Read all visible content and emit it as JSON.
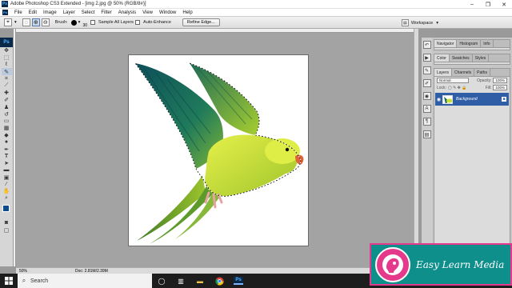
{
  "window": {
    "app_badge": "Ps",
    "title": "Adobe Photoshop CS3 Extended - [img 2.jpg @ 50% (RGB/8#)]",
    "controls": [
      "–",
      "❐",
      "✕"
    ]
  },
  "menu": [
    "File",
    "Edit",
    "Image",
    "Layer",
    "Select",
    "Filter",
    "Analysis",
    "View",
    "Window",
    "Help"
  ],
  "options": {
    "brush_label": "Brush:",
    "brush_size": "30",
    "sample_all_layers": "Sample All Layers",
    "auto_enhance": "Auto-Enhance",
    "refine_edge": "Refine Edge...",
    "workspace": "Workspace"
  },
  "toolbox": {
    "badge": "Ps",
    "tools": [
      "move",
      "marquee",
      "lasso",
      "quick-selection",
      "crop",
      "slice",
      "healing-brush",
      "brush",
      "clone-stamp",
      "history-brush",
      "eraser",
      "gradient",
      "blur",
      "dodge",
      "pen",
      "type",
      "path-selection",
      "shape",
      "notes",
      "eyedropper",
      "hand",
      "zoom"
    ],
    "colors": {
      "foreground": "#0d4d8f",
      "background": "#ffffff"
    }
  },
  "status": {
    "zoom": "50%",
    "doc": "Doc: 2.81M/2.39M"
  },
  "panels": {
    "navigator_tabs": [
      "Navigator",
      "Histogram",
      "Info"
    ],
    "color_tabs": [
      "Color",
      "Swatches",
      "Styles"
    ],
    "layers_tabs": [
      "Layers",
      "Channels",
      "Paths"
    ],
    "blend_mode": "Normal",
    "opacity_label": "Opacity:",
    "opacity_value": "100%",
    "lock_label": "Lock:",
    "fill_label": "Fill:",
    "fill_value": "100%",
    "layer_name": "Background"
  },
  "taskbar": {
    "search_placeholder": "Search"
  },
  "watermark": {
    "brand": "Easy Learn Media",
    "logo_lines": [
      "EASY LEARN",
      "MEDIA"
    ]
  }
}
